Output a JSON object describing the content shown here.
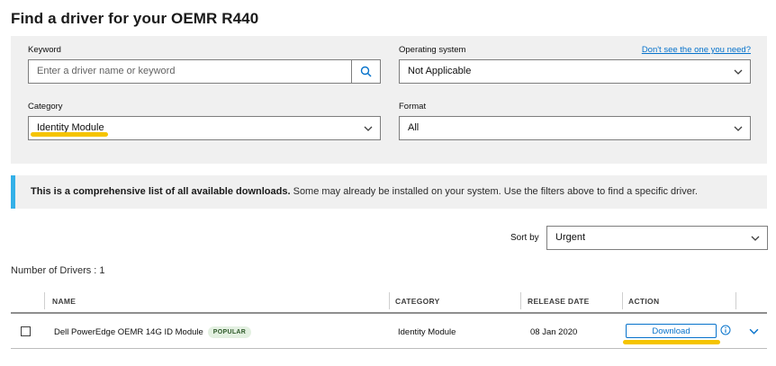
{
  "page_title": "Find a driver for your OEMR R440",
  "filters": {
    "keyword": {
      "label": "Keyword",
      "placeholder": "Enter a driver name or keyword",
      "value": ""
    },
    "os": {
      "label": "Operating system",
      "help_link": "Don't see the one you need?",
      "value": "Not Applicable"
    },
    "category": {
      "label": "Category",
      "value": "Identity Module"
    },
    "format": {
      "label": "Format",
      "value": "All"
    }
  },
  "notice": {
    "bold": "This is a comprehensive list of all available downloads.",
    "text": " Some may already be installed on your system. Use the filters above to find a specific driver."
  },
  "sort": {
    "label": "Sort by",
    "value": "Urgent"
  },
  "driver_count": "Number of Drivers : 1",
  "table": {
    "headers": {
      "name": "NAME",
      "category": "CATEGORY",
      "release_date": "RELEASE DATE",
      "action": "ACTION"
    },
    "rows": [
      {
        "name": "Dell PowerEdge OEMR 14G ID Module",
        "badge": "POPULAR",
        "category": "Identity Module",
        "release_date": "08 Jan 2020",
        "action": "Download"
      }
    ]
  },
  "colors": {
    "accent": "#0672cb",
    "highlight": "#f5c400",
    "notice_bar": "#34b0e8",
    "panel_bg": "#f0f0f0"
  },
  "icons": {
    "search": "search-icon",
    "dropdown": "chevron-down-icon",
    "info": "info-icon",
    "expand": "chevron-down-icon"
  }
}
